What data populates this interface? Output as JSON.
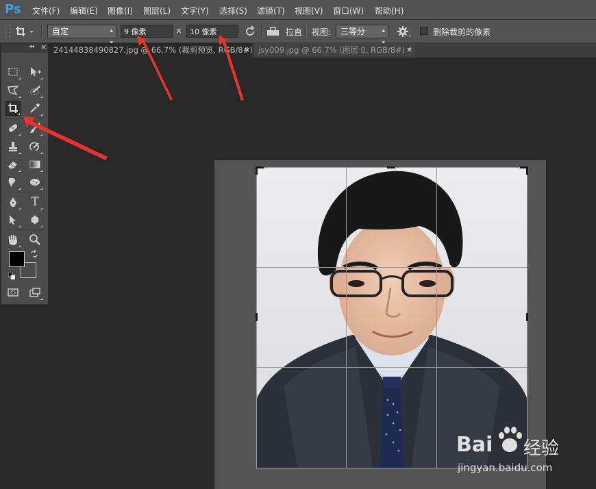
{
  "app": {
    "logo": "Ps"
  },
  "menu": [
    "文件(F)",
    "编辑(E)",
    "图像(I)",
    "图层(L)",
    "文字(Y)",
    "选择(S)",
    "滤镜(T)",
    "视图(V)",
    "窗口(W)",
    "帮助(H)"
  ],
  "options": {
    "ratio_value": "自定",
    "width_value": "9 像素",
    "times": "x",
    "height_value": "10 像素",
    "straighten_label": "拉直",
    "view_label": "视图:",
    "view_value": "三等分",
    "delete_cropped_label": "删除裁剪的像素"
  },
  "tabs": [
    {
      "label": "24144838490827.jpg @ 66.7% (裁剪预览, RGB/8#) *",
      "close": "×",
      "active": true
    },
    {
      "label": "jsy009.jpg @ 66.7% (图层 0, RGB/8#) *",
      "close": "×",
      "active": false
    }
  ],
  "toolbox": {
    "collapse": "◂◂",
    "close": "×",
    "type_tool_letter": "T"
  },
  "watermark": {
    "brand": "Bai",
    "brand_cn": "经验",
    "url": "jingyan.baidu.com"
  },
  "colors": {
    "foreground": "#000000",
    "background": "#ffffff",
    "annotation_arrow": "#e8332b",
    "accent": "#3ba3e0"
  }
}
